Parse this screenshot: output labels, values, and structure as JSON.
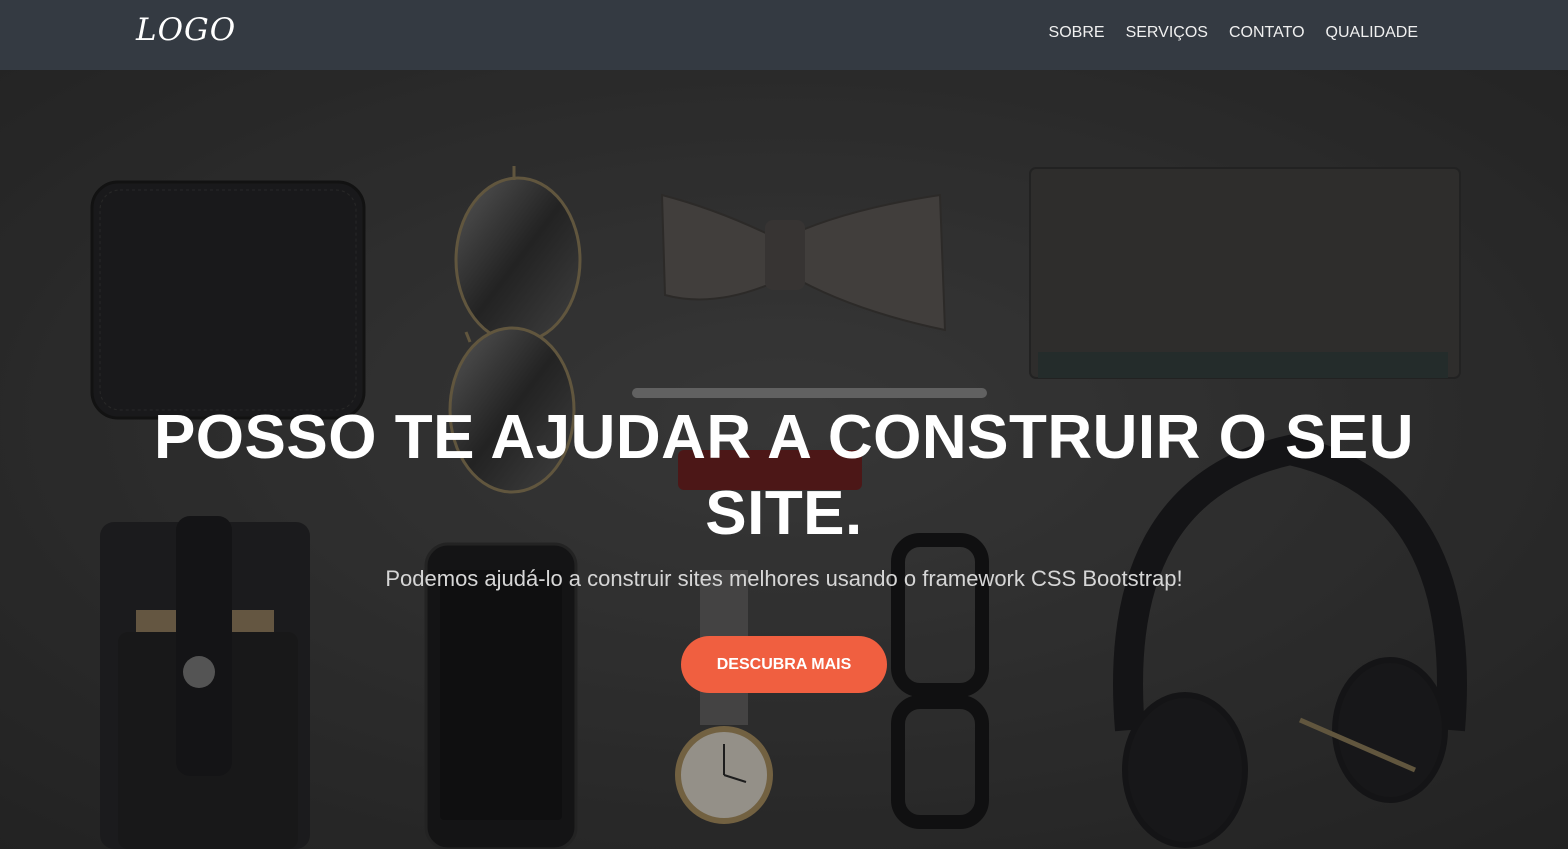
{
  "navbar": {
    "logo": "LOGO",
    "links": [
      "SOBRE",
      "SERVIÇOS",
      "CONTATO",
      "QUALIDADE"
    ]
  },
  "hero": {
    "title": "POSSO TE AJUDAR A CONSTRUIR O SEU SITE.",
    "subtitle": "Podemos ajudá-lo a construir sites melhores usando o framework CSS Bootstrap!",
    "cta_label": "DESCUBRA MAIS"
  },
  "colors": {
    "navbar_bg": "#343a42",
    "cta_bg": "#f05f40",
    "hero_bg": "#3a3a3a"
  }
}
